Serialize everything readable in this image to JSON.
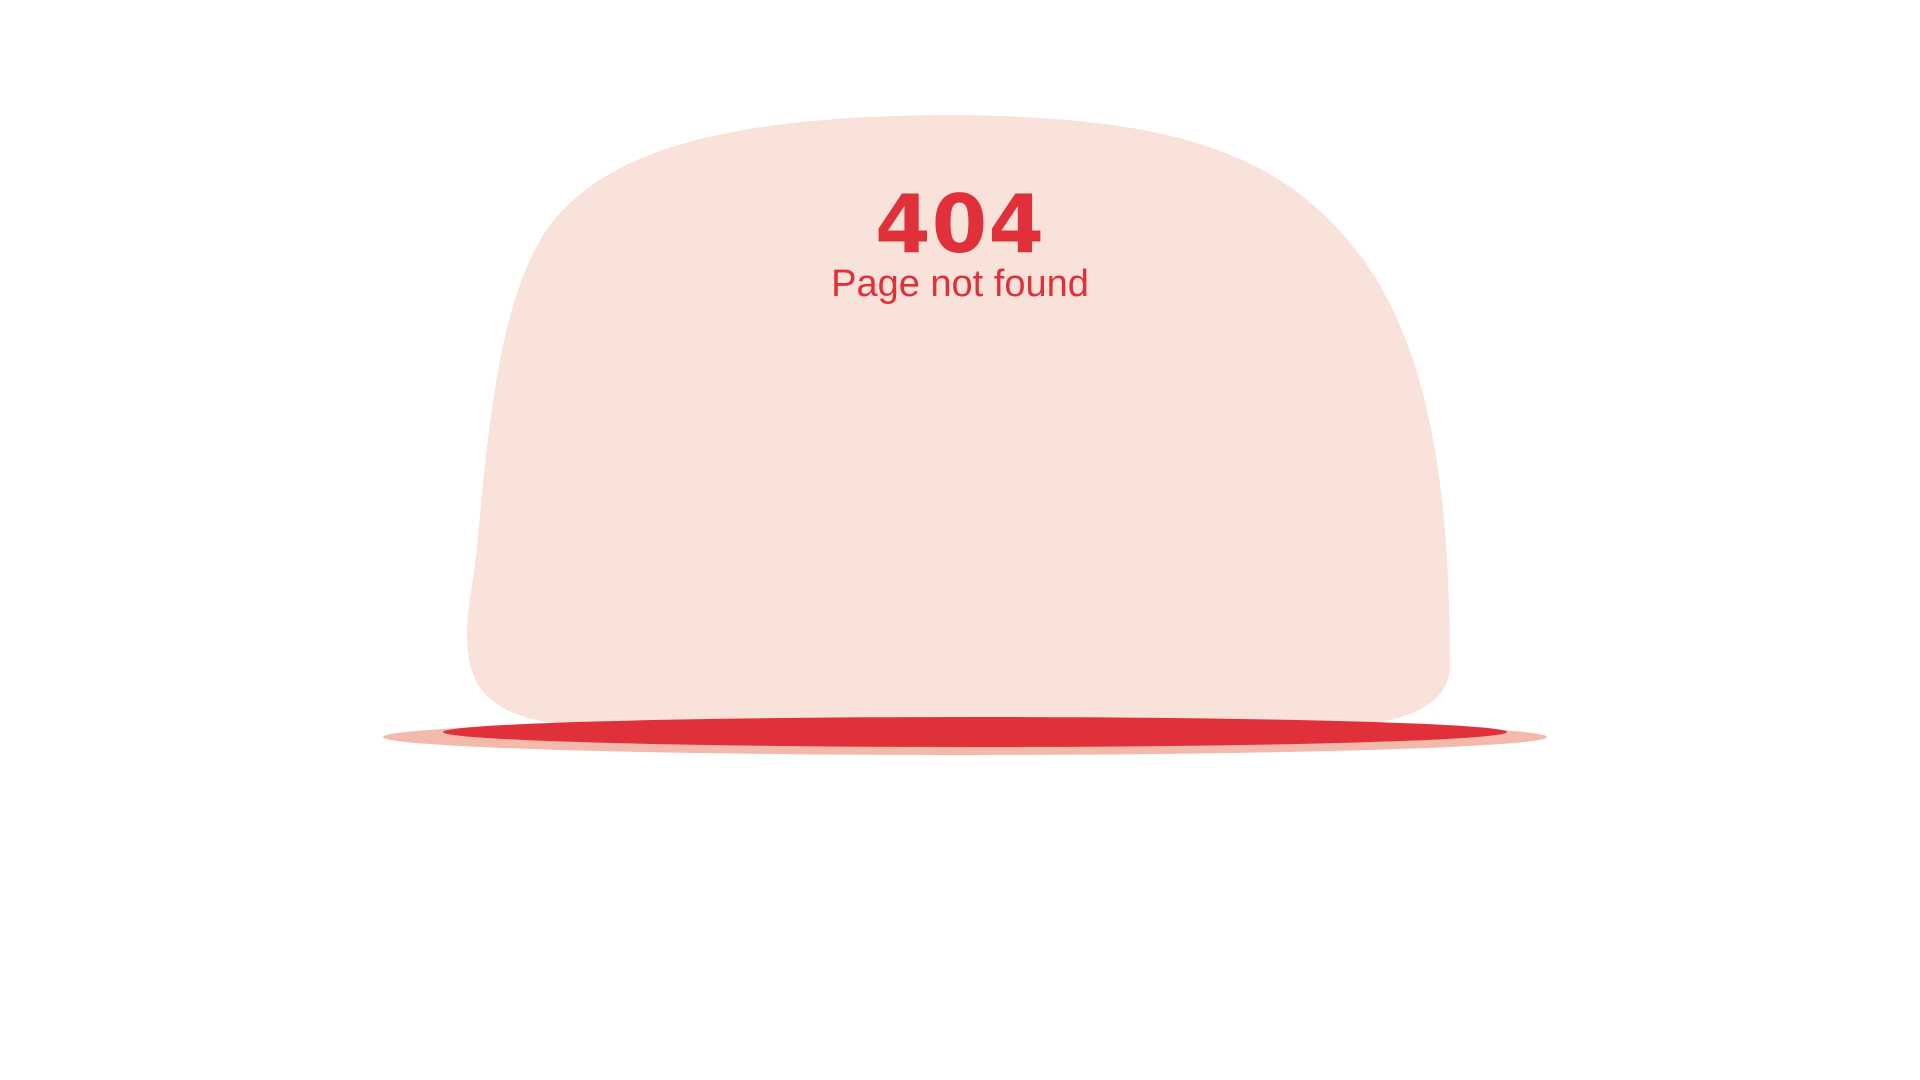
{
  "error": {
    "code": "404",
    "message": "Page not found"
  },
  "colors": {
    "background": "#ffffff",
    "blob": "#f9e2da",
    "accent": "#e0313b",
    "brim": "#f3b9aa"
  },
  "icons": {
    "illustration": "hat-icon"
  }
}
